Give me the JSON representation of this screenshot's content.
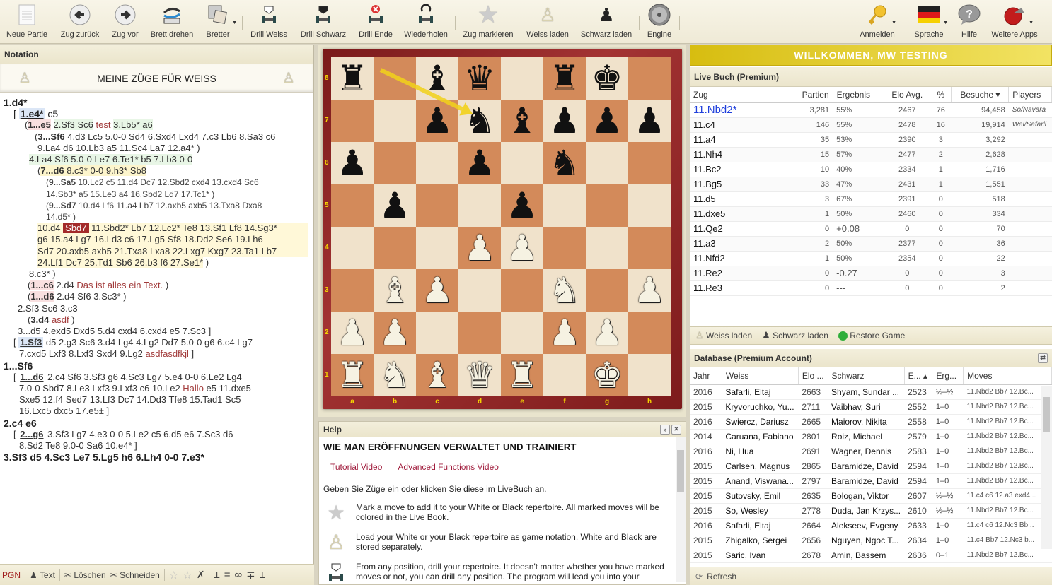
{
  "toolbar": {
    "items": [
      {
        "label": "Neue Partie",
        "icon": "new-document-icon"
      },
      {
        "label": "Zug zurück",
        "icon": "arrow-left-icon"
      },
      {
        "label": "Zug vor",
        "icon": "arrow-right-icon"
      },
      {
        "label": "Brett drehen",
        "icon": "rotate-board-icon"
      },
      {
        "label": "Bretter",
        "icon": "boards-icon"
      },
      {
        "label": "Drill Weiss",
        "icon": "drill-white-icon"
      },
      {
        "label": "Drill Schwarz",
        "icon": "drill-black-icon"
      },
      {
        "label": "Drill Ende",
        "icon": "drill-end-icon"
      },
      {
        "label": "Wiederholen",
        "icon": "repeat-icon"
      },
      {
        "label": "Zug markieren",
        "icon": "star-icon"
      },
      {
        "label": "Weiss laden",
        "icon": "white-pawn-icon"
      },
      {
        "label": "Schwarz laden",
        "icon": "black-pawn-icon"
      },
      {
        "label": "Engine",
        "icon": "engine-icon"
      },
      {
        "label": "Anmelden",
        "icon": "key-icon"
      },
      {
        "label": "Sprache",
        "icon": "german-flag-icon"
      },
      {
        "label": "Hilfe",
        "icon": "help-bubble-icon"
      },
      {
        "label": "Weitere Apps",
        "icon": "more-apps-icon"
      }
    ]
  },
  "notation": {
    "title": "Notation",
    "repertoire_label": "MEINE ZÜGE FÜR WEISS",
    "bottom_bar": {
      "pgn": "PGN",
      "text": "Text",
      "delete": "Löschen",
      "cut": "Schneiden",
      "symbols": [
        "±",
        "=",
        "∞",
        "∓",
        "±"
      ]
    }
  },
  "board": {
    "ranks": [
      "8",
      "7",
      "6",
      "5",
      "4",
      "3",
      "2",
      "1"
    ],
    "files": [
      "a",
      "b",
      "c",
      "d",
      "e",
      "f",
      "g",
      "h"
    ],
    "position": [
      [
        "bR",
        "",
        "bB",
        "bQ",
        "",
        "bR",
        "bK",
        ""
      ],
      [
        "",
        "",
        "bP",
        "bN",
        "bB",
        "bP",
        "bP",
        "bP"
      ],
      [
        "bP",
        "",
        "",
        "bP",
        "",
        "bN",
        "",
        ""
      ],
      [
        "",
        "bP",
        "",
        "",
        "bP",
        "",
        "",
        ""
      ],
      [
        "",
        "",
        "",
        "wP",
        "wP",
        "",
        "",
        ""
      ],
      [
        "",
        "wB",
        "wP",
        "",
        "",
        "wN",
        "",
        "wP"
      ],
      [
        "wP",
        "wP",
        "",
        "",
        "",
        "wP",
        "wP",
        ""
      ],
      [
        "wR",
        "wN",
        "wB",
        "wQ",
        "wR",
        "",
        "wK",
        ""
      ]
    ],
    "arrow": {
      "from": "b8",
      "to": "d7",
      "color": "#f2d21a"
    }
  },
  "help": {
    "title": "Help",
    "heading": "WIE MAN ERÖFFNUNGEN VERWALTET UND TRAINIERT",
    "links": [
      "Tutorial Video",
      "Advanced Functions Video"
    ],
    "intro": "Geben Sie Züge ein oder klicken Sie diese im LiveBuch an.",
    "items": [
      {
        "icon": "star-icon",
        "text": "Mark a move to add it to your White or Black repertoire. All marked moves will be colored in the Live Book."
      },
      {
        "icon": "white-pawn-icon",
        "text": "Load your White or your Black repertoire as game notation. White and Black are stored separately."
      },
      {
        "icon": "drill-icon",
        "text": "From any position, drill your repertoire. It doesn't matter whether you have marked moves or not, you can drill any position. The program will lead you into your"
      }
    ]
  },
  "welcome": "WILLKOMMEN, MW TESTING",
  "livebook": {
    "title": "Live Buch (Premium)",
    "columns": [
      "Zug",
      "Partien",
      "Ergebnis",
      "Elo Avg.",
      "%",
      "Besuche",
      "Players"
    ],
    "rows": [
      {
        "move": "11.Nbd2*",
        "games": "3,281",
        "result": "55%",
        "elo": "2467",
        "pct": "76",
        "visits": "94,458",
        "players": "So/Navara"
      },
      {
        "move": "11.c4",
        "games": "146",
        "result": "55%",
        "elo": "2478",
        "pct": "16",
        "visits": "19,914",
        "players": "Wei/Safarli"
      },
      {
        "move": "11.a4",
        "games": "35",
        "result": "53%",
        "elo": "2390",
        "pct": "3",
        "visits": "3,292",
        "players": ""
      },
      {
        "move": "11.Nh4",
        "games": "15",
        "result": "57%",
        "elo": "2477",
        "pct": "2",
        "visits": "2,628",
        "players": ""
      },
      {
        "move": "11.Bc2",
        "games": "10",
        "result": "40%",
        "elo": "2334",
        "pct": "1",
        "visits": "1,716",
        "players": ""
      },
      {
        "move": "11.Bg5",
        "games": "33",
        "result": "47%",
        "elo": "2431",
        "pct": "1",
        "visits": "1,551",
        "players": ""
      },
      {
        "move": "11.d5",
        "games": "3",
        "result": "67%",
        "elo": "2391",
        "pct": "0",
        "visits": "518",
        "players": ""
      },
      {
        "move": "11.dxe5",
        "games": "1",
        "result": "50%",
        "elo": "2460",
        "pct": "0",
        "visits": "334",
        "players": ""
      },
      {
        "move": "11.Qe2",
        "games": "0",
        "result": "+0.08",
        "elo": "0",
        "pct": "0",
        "visits": "70",
        "players": ""
      },
      {
        "move": "11.a3",
        "games": "2",
        "result": "50%",
        "elo": "2377",
        "pct": "0",
        "visits": "36",
        "players": ""
      },
      {
        "move": "11.Nfd2",
        "games": "1",
        "result": "50%",
        "elo": "2354",
        "pct": "0",
        "visits": "22",
        "players": ""
      },
      {
        "move": "11.Re2",
        "games": "0",
        "result": "-0.27",
        "elo": "0",
        "pct": "0",
        "visits": "3",
        "players": ""
      },
      {
        "move": "11.Re3",
        "games": "0",
        "result": "---",
        "elo": "0",
        "pct": "0",
        "visits": "2",
        "players": ""
      }
    ],
    "actions": [
      "Weiss laden",
      "Schwarz laden",
      "Restore Game"
    ]
  },
  "database": {
    "title": "Database (Premium Account)",
    "columns": [
      "Jahr",
      "Weiss",
      "Elo ...",
      "Schwarz",
      "E...",
      "Erg...",
      "Moves"
    ],
    "rows": [
      [
        "2016",
        "Safarli, Eltaj",
        "2663",
        "Shyam, Sundar ...",
        "2523",
        "½–½",
        "11.Nbd2 Bb7 12.Bc..."
      ],
      [
        "2015",
        "Kryvoruchko, Yu...",
        "2711",
        "Vaibhav, Suri",
        "2552",
        "1–0",
        "11.Nbd2 Bb7 12.Bc..."
      ],
      [
        "2016",
        "Swiercz, Dariusz",
        "2665",
        "Maiorov, Nikita",
        "2558",
        "1–0",
        "11.Nbd2 Bb7 12.Bc..."
      ],
      [
        "2014",
        "Caruana, Fabiano",
        "2801",
        "Roiz, Michael",
        "2579",
        "1–0",
        "11.Nbd2 Bb7 12.Bc..."
      ],
      [
        "2016",
        "Ni, Hua",
        "2691",
        "Wagner, Dennis",
        "2583",
        "1–0",
        "11.Nbd2 Bb7 12.Bc..."
      ],
      [
        "2015",
        "Carlsen, Magnus",
        "2865",
        "Baramidze, David",
        "2594",
        "1–0",
        "11.Nbd2 Bb7 12.Bc..."
      ],
      [
        "2015",
        "Anand, Viswana...",
        "2797",
        "Baramidze, David",
        "2594",
        "1–0",
        "11.Nbd2 Bb7 12.Bc..."
      ],
      [
        "2015",
        "Sutovsky, Emil",
        "2635",
        "Bologan, Viktor",
        "2607",
        "½–½",
        "11.c4 c6 12.a3 exd4..."
      ],
      [
        "2015",
        "So, Wesley",
        "2778",
        "Duda, Jan Krzys...",
        "2610",
        "½–½",
        "11.Nbd2 Bb7 12.Bc..."
      ],
      [
        "2016",
        "Safarli, Eltaj",
        "2664",
        "Alekseev, Evgeny",
        "2633",
        "1–0",
        "11.c4 c6 12.Nc3 Bb..."
      ],
      [
        "2015",
        "Zhigalko, Sergei",
        "2656",
        "Nguyen, Ngoc T...",
        "2634",
        "1–0",
        "11.c4 Bb7 12.Nc3 b..."
      ],
      [
        "2015",
        "Saric, Ivan",
        "2678",
        "Amin, Bassem",
        "2636",
        "0–1",
        "11.Nbd2 Bb7 12.Bc..."
      ]
    ],
    "refresh": "Refresh"
  }
}
